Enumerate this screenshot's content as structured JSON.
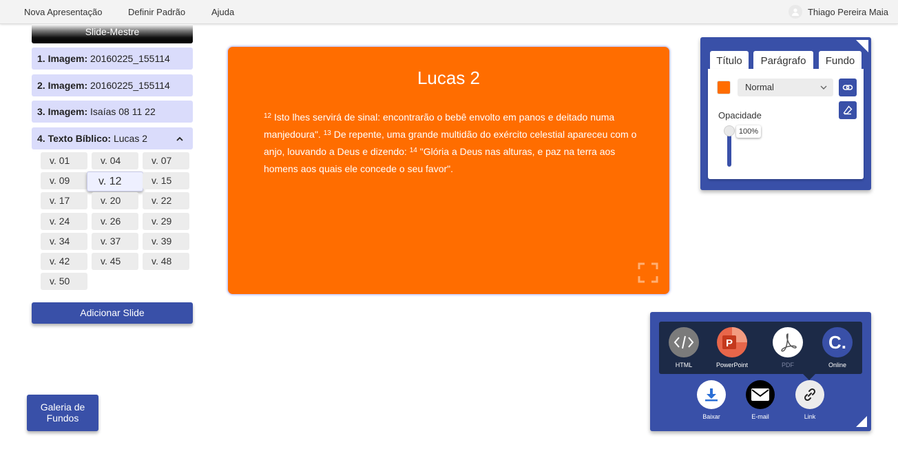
{
  "topbar": {
    "menu": [
      {
        "label": "Nova Apresentação"
      },
      {
        "label": "Definir Padrão"
      },
      {
        "label": "Ajuda"
      }
    ],
    "user_name": "Thiago Pereira Maia"
  },
  "sidebar": {
    "master_label": "Slide-Mestre",
    "slides": [
      {
        "kind": "1. Imagem:",
        "name": "20160225_155114"
      },
      {
        "kind": "2. Imagem:",
        "name": "20160225_155114"
      },
      {
        "kind": "3. Imagem:",
        "name": "Isaías 08 11 22"
      },
      {
        "kind": "4. Texto Bíblico:",
        "name": "Lucas 2"
      }
    ],
    "verses": [
      "v. 01",
      "v. 04",
      "v. 07",
      "v. 09",
      "v. 12",
      "v. 15",
      "v. 17",
      "v. 20",
      "v. 22",
      "v. 24",
      "v. 26",
      "v. 29",
      "v. 34",
      "v. 37",
      "v. 39",
      "v. 42",
      "v. 45",
      "v. 48",
      "v. 50"
    ],
    "active_verse": "v. 12",
    "add_slide_label": "Adicionar Slide",
    "gallery_label_line1": "Galeria de",
    "gallery_label_line2": "Fundos"
  },
  "slide": {
    "background_color": "#ff6d00",
    "title": "Lucas 2",
    "verses": [
      {
        "num": "12",
        "text": " Isto lhes servirá de sinal: encontrarão o bebê envolto em panos e deitado numa manjedoura\". "
      },
      {
        "num": "13",
        "text": " De repente, uma grande multidão do exército celestial apareceu com o anjo, louvando a Deus e dizendo: "
      },
      {
        "num": "14",
        "text": " \"Glória a Deus nas alturas, e paz na terra aos homens aos quais ele concede o seu favor\"."
      }
    ]
  },
  "properties": {
    "tabs": [
      {
        "label": "Título"
      },
      {
        "label": "Parágrafo"
      },
      {
        "label": "Fundo"
      }
    ],
    "active_tab": "Fundo",
    "color": "#ff6d00",
    "blend_mode": "Normal",
    "opacity_label": "Opacidade",
    "opacity_value": "100%"
  },
  "export": {
    "formats": [
      {
        "label": "HTML",
        "icon": "code-icon"
      },
      {
        "label": "PowerPoint",
        "icon": "powerpoint-icon"
      },
      {
        "label": "PDF",
        "icon": "pdf-icon"
      },
      {
        "label": "Online",
        "icon": "online-icon"
      }
    ],
    "actions": [
      {
        "label": "Baixar",
        "icon": "download-icon"
      },
      {
        "label": "E-mail",
        "icon": "email-icon"
      },
      {
        "label": "Link",
        "icon": "link-icon"
      }
    ],
    "accent": "#3950a8",
    "online_letter": "C."
  }
}
